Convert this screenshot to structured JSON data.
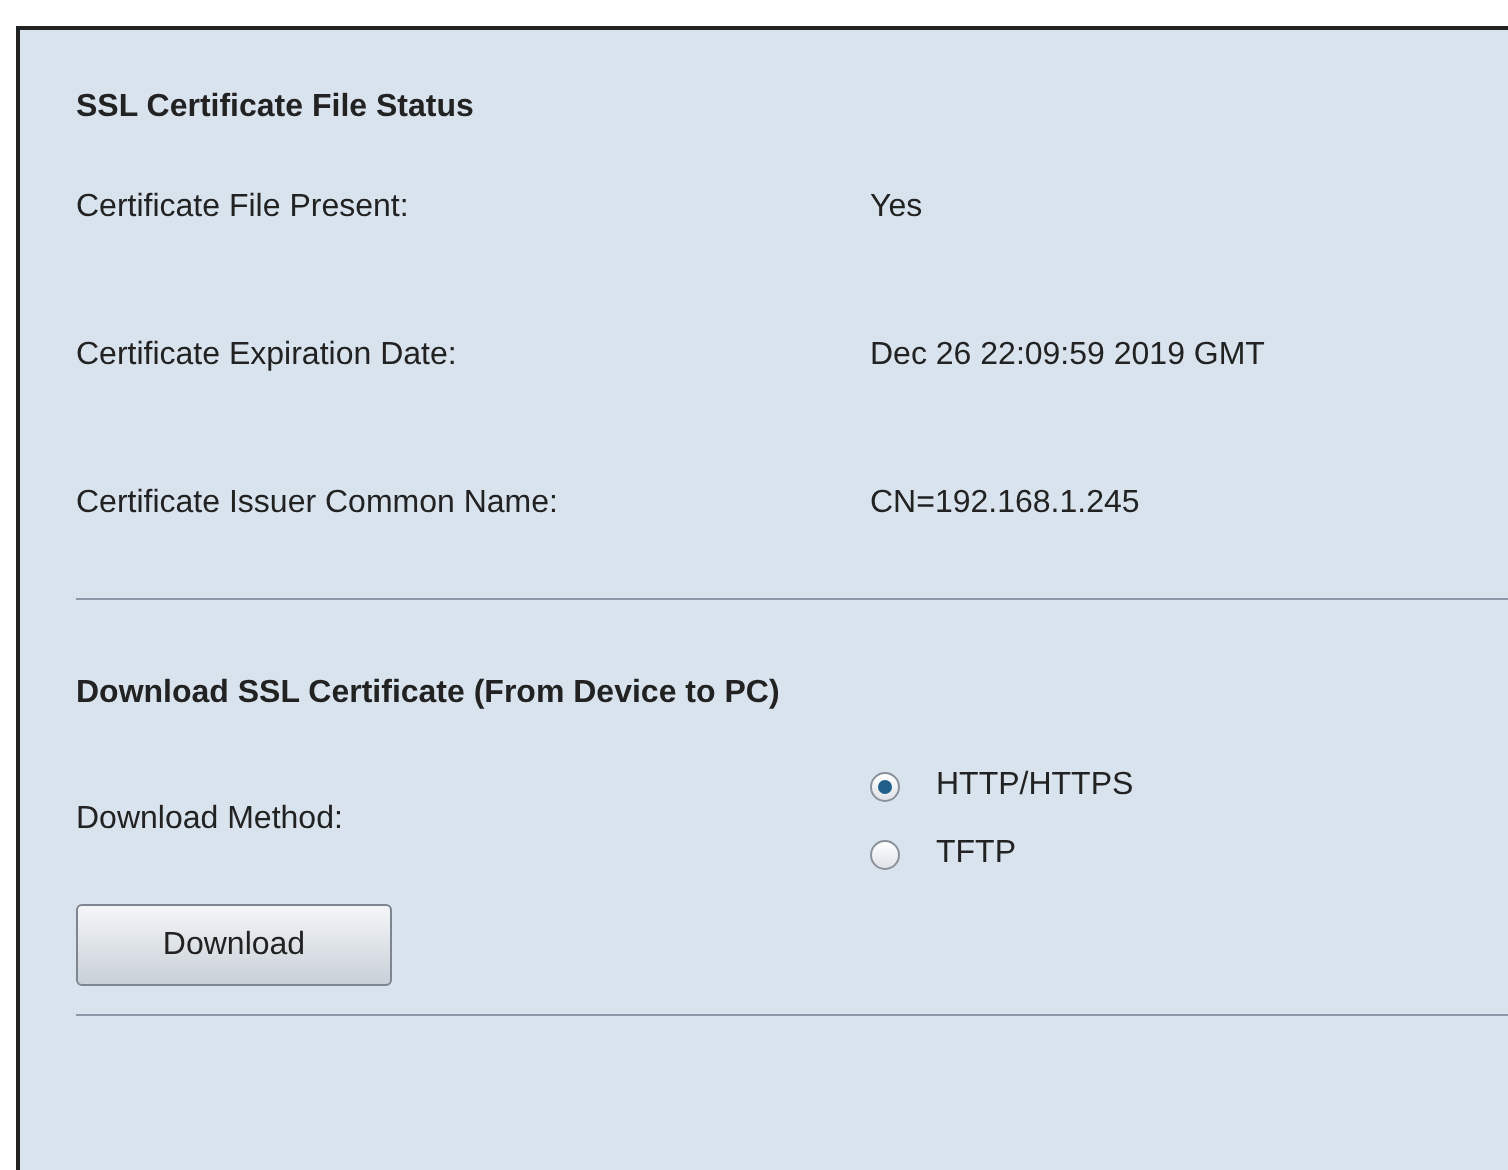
{
  "status_section": {
    "title": "SSL Certificate File Status",
    "rows": [
      {
        "label": "Certificate File Present:",
        "value": "Yes"
      },
      {
        "label": "Certificate Expiration Date:",
        "value": "Dec 26 22:09:59 2019 GMT"
      },
      {
        "label": "Certificate Issuer Common Name:",
        "value": "CN=192.168.1.245"
      }
    ]
  },
  "download_section": {
    "title": "Download SSL Certificate (From Device to PC)",
    "method_label": "Download Method:",
    "options": [
      {
        "label": "HTTP/HTTPS",
        "selected": true
      },
      {
        "label": "TFTP",
        "selected": false
      }
    ],
    "button": "Download"
  }
}
